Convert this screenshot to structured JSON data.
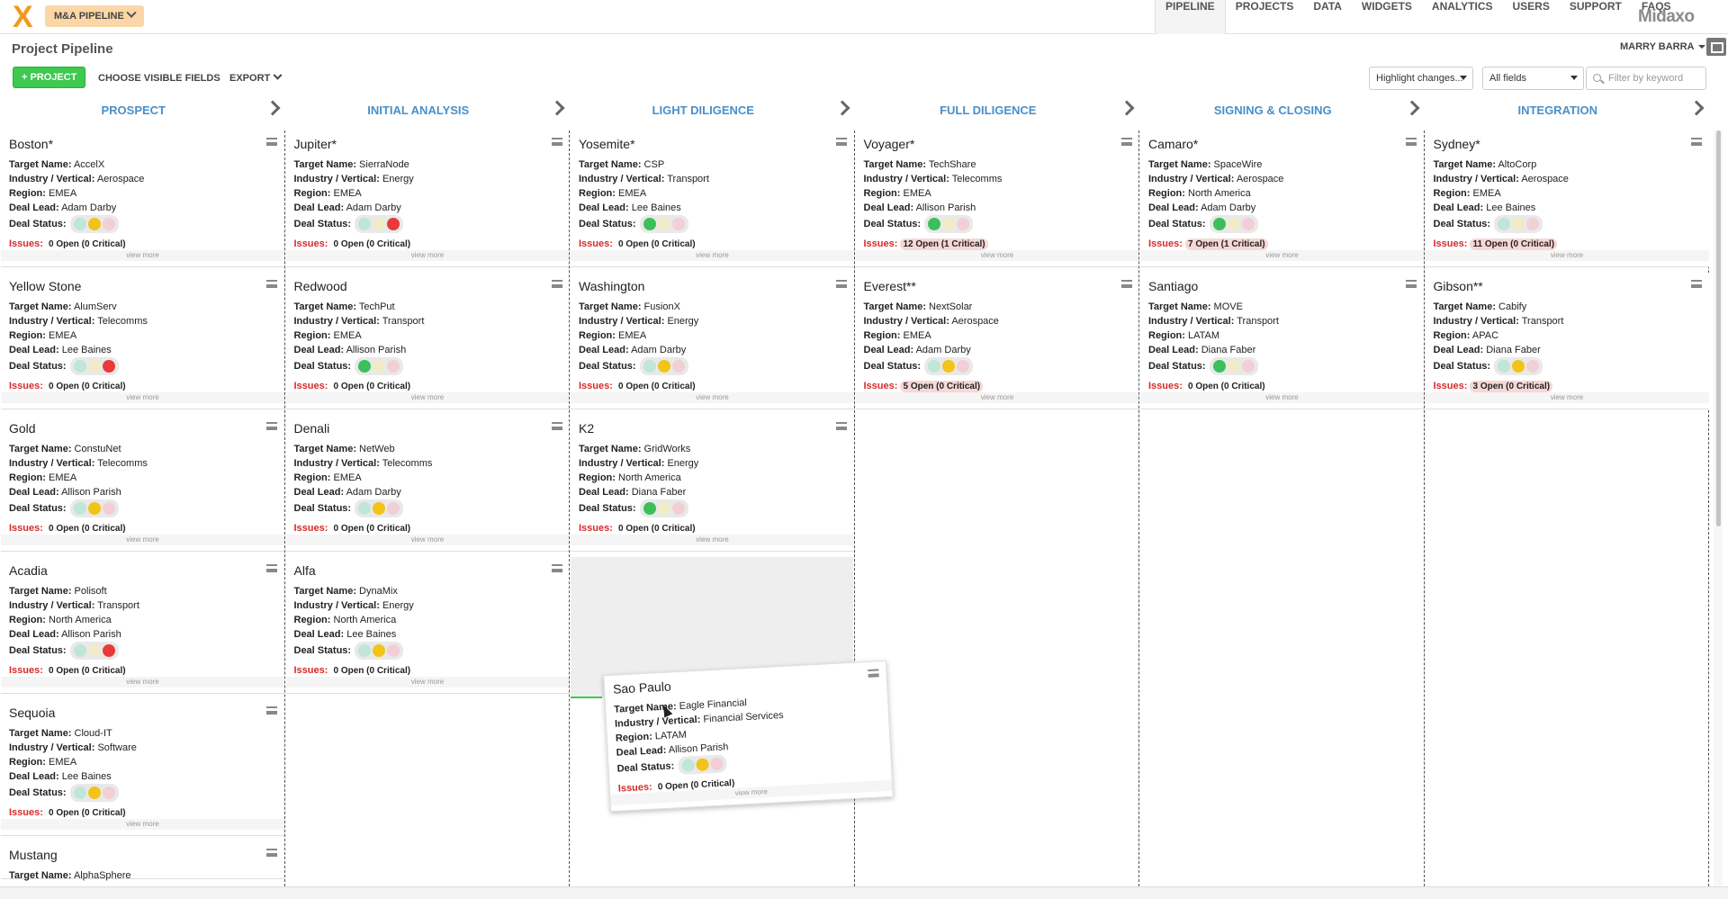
{
  "topbar": {
    "logo": "X",
    "pipeline_selector": "M&A PIPELINE",
    "nav": [
      "PIPELINE",
      "PROJECTS",
      "DATA",
      "WIDGETS",
      "ANALYTICS",
      "USERS",
      "SUPPORT",
      "FAQS"
    ],
    "active_nav": "PIPELINE",
    "brand": "Midaxo"
  },
  "header": {
    "title": "Project Pipeline",
    "user": "MARRY BARRA",
    "add_project": "+ PROJECT",
    "choose_fields": "CHOOSE VISIBLE FIELDS",
    "export": "EXPORT",
    "highlight_select": "Highlight changes...",
    "fields_select": "All fields",
    "filter_placeholder": "Filter by keyword"
  },
  "labels": {
    "target": "Target Name:",
    "industry": "Industry / Vertical:",
    "region": "Region:",
    "lead": "Deal Lead:",
    "status": "Deal Status:",
    "issues": "Issues:",
    "view_more": "view more"
  },
  "colors": {
    "green": "#3cbf5a",
    "yellow": "#f2c318",
    "red": "#e83a3a",
    "green_off": "#bfe6d6",
    "yellow_off": "#f1ebc7",
    "red_off": "#f1cfd5",
    "stage_header": "#4a8fc8",
    "accent": "#f29a1d"
  },
  "stages": [
    {
      "name": "PROSPECT",
      "cards": [
        {
          "name": "Boston*",
          "target": "AccelX",
          "industry": "Aerospace",
          "region": "EMEA",
          "lead": "Adam Darby",
          "status": "yellow-red",
          "issues": "0 Open (0 Critical)"
        },
        {
          "name": "Yellow Stone",
          "target": "AlumServ",
          "industry": "Telecomms",
          "region": "EMEA",
          "lead": "Lee Baines",
          "status": "red",
          "issues": "0 Open (0 Critical)"
        },
        {
          "name": "Gold",
          "target": "ConstuNet",
          "industry": "Telecomms",
          "region": "EMEA",
          "lead": "Allison Parish",
          "status": "yellow",
          "issues": "0 Open (0 Critical)"
        },
        {
          "name": "Acadia",
          "target": "Polisoft",
          "industry": "Transport",
          "region": "North America",
          "lead": "Allison Parish",
          "status": "red",
          "issues": "0 Open (0 Critical)"
        },
        {
          "name": "Sequoia",
          "target": "Cloud-IT",
          "industry": "Software",
          "region": "EMEA",
          "lead": "Lee Baines",
          "status": "yellow",
          "issues": "0 Open (0 Critical)"
        },
        {
          "name": "Mustang",
          "target": "AlphaSphere",
          "industry": "",
          "region": "",
          "lead": "",
          "status": "",
          "issues": ""
        }
      ]
    },
    {
      "name": "INITIAL ANALYSIS",
      "cards": [
        {
          "name": "Jupiter*",
          "target": "SierraNode",
          "industry": "Energy",
          "region": "EMEA",
          "lead": "Adam Darby",
          "status": "red",
          "issues": "0 Open (0 Critical)"
        },
        {
          "name": "Redwood",
          "target": "TechPut",
          "industry": "Transport",
          "region": "EMEA",
          "lead": "Allison Parish",
          "status": "green",
          "issues": "0 Open (0 Critical)"
        },
        {
          "name": "Denali",
          "target": "NetWeb",
          "industry": "Telecomms",
          "region": "EMEA",
          "lead": "Adam Darby",
          "status": "yellow",
          "issues": "0 Open (0 Critical)"
        },
        {
          "name": "Alfa",
          "target": "DynaMix",
          "industry": "Energy",
          "region": "North America",
          "lead": "Lee Baines",
          "status": "yellow",
          "issues": "0 Open (0 Critical)"
        }
      ]
    },
    {
      "name": "LIGHT DILIGENCE",
      "cards": [
        {
          "name": "Yosemite*",
          "target": "CSP",
          "industry": "Transport",
          "region": "EMEA",
          "lead": "Lee Baines",
          "status": "green",
          "issues": "0 Open (0 Critical)"
        },
        {
          "name": "Washington",
          "target": "FusionX",
          "industry": "Energy",
          "region": "EMEA",
          "lead": "Adam Darby",
          "status": "yellow",
          "issues": "0 Open (0 Critical)"
        },
        {
          "name": "K2",
          "target": "GridWorks",
          "industry": "Energy",
          "region": "North America",
          "lead": "Diana Faber",
          "status": "green",
          "issues": "0 Open (0 Critical)"
        }
      ]
    },
    {
      "name": "FULL DILIGENCE",
      "cards": [
        {
          "name": "Voyager*",
          "target": "TechShare",
          "industry": "Telecomms",
          "region": "EMEA",
          "lead": "Allison Parish",
          "status": "green",
          "issues": "12 Open (1 Critical)",
          "hot": true
        },
        {
          "name": "Everest**",
          "target": "NextSolar",
          "industry": "Aerospace",
          "region": "EMEA",
          "lead": "Adam Darby",
          "status": "yellow",
          "issues": "5 Open (0 Critical)",
          "hot": true
        }
      ]
    },
    {
      "name": "SIGNING & CLOSING",
      "cards": [
        {
          "name": "Camaro*",
          "target": "SpaceWire",
          "industry": "Aerospace",
          "region": "North America",
          "lead": "Adam Darby",
          "status": "green",
          "issues": "7 Open (1 Critical)",
          "hot": true
        },
        {
          "name": "Santiago",
          "target": "MOVE",
          "industry": "Transport",
          "region": "LATAM",
          "lead": "Diana Faber",
          "status": "green",
          "issues": "0 Open (0 Critical)"
        }
      ]
    },
    {
      "name": "INTEGRATION",
      "cards": [
        {
          "name": "Sydney*",
          "target": "AltoCorp",
          "industry": "Aerospace",
          "region": "EMEA",
          "lead": "Lee Baines",
          "status": "none",
          "issues": "11 Open (0 Critical)",
          "hot": true
        },
        {
          "name": "Gibson**",
          "target": "Cabify",
          "industry": "Transport",
          "region": "APAC",
          "lead": "Diana Faber",
          "status": "yellow",
          "issues": "3 Open (0 Critical)",
          "hot": true
        }
      ]
    }
  ],
  "dragging_card": {
    "name": "Sao Paulo",
    "target": "Eagle Financial",
    "industry": "Financial Services",
    "region": "LATAM",
    "lead": "Allison Parish",
    "status": "yellow",
    "issues": "0 Open (0 Critical)"
  }
}
